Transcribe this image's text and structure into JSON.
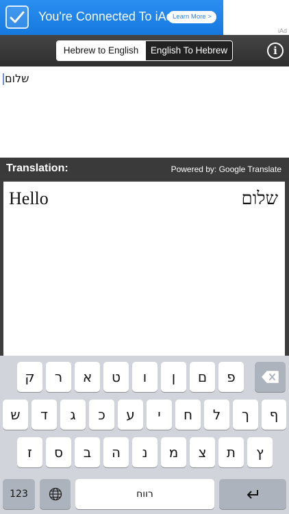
{
  "ad": {
    "text": "You're Connected To iAd",
    "learn_more": "Learn More >",
    "tag": "iAd"
  },
  "nav": {
    "segments": [
      "Hebrew to English",
      "English To Hebrew"
    ],
    "selected": "English To Hebrew",
    "info_label": "i"
  },
  "input": {
    "value": "שלום"
  },
  "translation": {
    "title": "Translation:",
    "powered_by": "Powered by: Google Translate",
    "english": "Hello",
    "hebrew": "שלום"
  },
  "keyboard": {
    "row1": [
      "ק",
      "ר",
      "א",
      "ט",
      "ו",
      "ן",
      "ם",
      "פ"
    ],
    "row2": [
      "ש",
      "ד",
      "ג",
      "כ",
      "ע",
      "י",
      "ח",
      "ל",
      "ך",
      "ף"
    ],
    "row3": [
      "ז",
      "ס",
      "ב",
      "ה",
      "נ",
      "מ",
      "צ",
      "ת",
      "ץ"
    ],
    "numbers_key": "123",
    "space_key": "רווח"
  },
  "colors": {
    "ad_blue": "#1f84e8",
    "nav_dark": "#3a3a3a",
    "keyboard_bg": "#d1d5db"
  }
}
